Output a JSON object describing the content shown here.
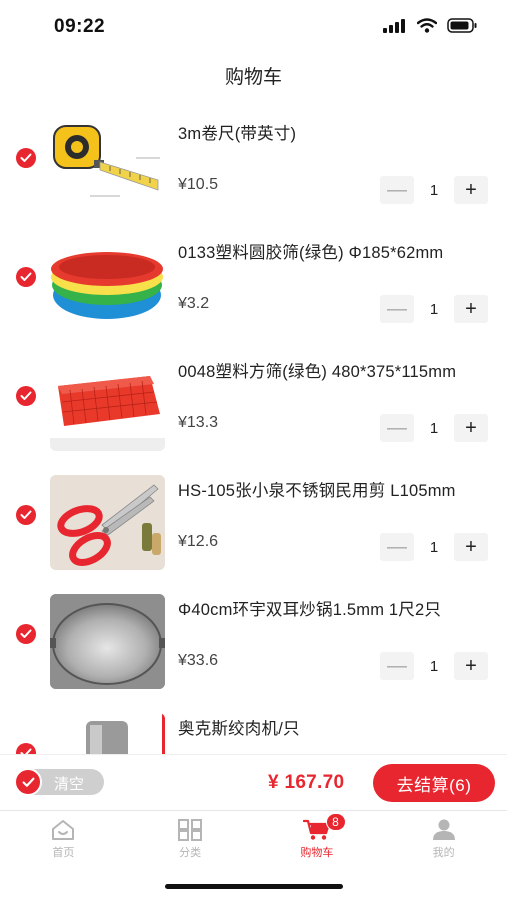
{
  "status_bar": {
    "time": "09:22"
  },
  "nav": {
    "title": "购物车"
  },
  "cart": {
    "items": [
      {
        "title": "3m卷尺(带英寸)",
        "price": "¥10.5",
        "qty": "1",
        "image": "tape-measure"
      },
      {
        "title": "0133塑料圆胶筛(绿色)   Φ185*62mm",
        "price": "¥3.2",
        "qty": "1",
        "image": "plastic-basins"
      },
      {
        "title": "0048塑料方筛(绿色) 480*375*115mm",
        "price": "¥13.3",
        "qty": "1",
        "image": "plastic-square-sieve"
      },
      {
        "title": "HS-105张小泉不锈钢民用剪 L105mm",
        "price": "¥12.6",
        "qty": "1",
        "image": "scissors"
      },
      {
        "title": "Φ40cm环宇双耳炒锅1.5mm 1尺2只",
        "price": "¥33.6",
        "qty": "1",
        "image": "wok"
      },
      {
        "title": "奥克斯绞肉机/只",
        "price": "",
        "qty": "",
        "image": "meat-grinder"
      }
    ],
    "minus_symbol": "—",
    "plus_symbol": "+"
  },
  "bottom": {
    "clear_label": "清空",
    "total": "¥ 167.70",
    "checkout_label": "去结算(6)"
  },
  "tabbar": {
    "tabs": [
      {
        "label": "首页",
        "icon": "home-icon",
        "active": false
      },
      {
        "label": "分类",
        "icon": "grid-icon",
        "active": false
      },
      {
        "label": "购物车",
        "icon": "cart-icon",
        "active": true,
        "badge": "8"
      },
      {
        "label": "我的",
        "icon": "user-icon",
        "active": false
      }
    ]
  },
  "colors": {
    "accent": "#e8262f",
    "muted": "#b5b5b5",
    "stepper_bg": "#f3f3f3"
  }
}
